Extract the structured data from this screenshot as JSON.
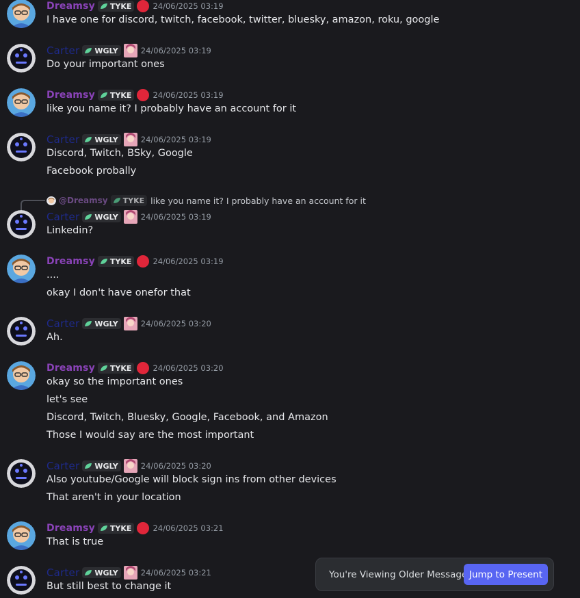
{
  "users": {
    "dreamsy": {
      "name": "Dreamsy",
      "tag": "TYKE"
    },
    "carter": {
      "name": "Carter",
      "tag": "WGLY"
    }
  },
  "messages": [
    {
      "user": "dreamsy",
      "time": "24/06/2025 03:19",
      "lines": [
        "I have one for discord, twitch, facebook, twitter, bluesky, amazon, roku, google"
      ]
    },
    {
      "user": "carter",
      "time": "24/06/2025 03:19",
      "lines": [
        "Do your important ones"
      ]
    },
    {
      "user": "dreamsy",
      "time": "24/06/2025 03:19",
      "lines": [
        "like you name it? I probably have an account for it"
      ]
    },
    {
      "user": "carter",
      "time": "24/06/2025 03:19",
      "lines": [
        "Discord, Twitch, BSky, Google",
        "Facebook probally"
      ]
    },
    {
      "user": "carter",
      "time": "24/06/2025 03:19",
      "lines": [
        "Linkedin?"
      ]
    },
    {
      "user": "dreamsy",
      "time": "24/06/2025 03:19",
      "lines": [
        "....",
        "okay I don't have onefor that"
      ]
    },
    {
      "user": "carter",
      "time": "24/06/2025 03:20",
      "lines": [
        "Ah."
      ]
    },
    {
      "user": "dreamsy",
      "time": "24/06/2025 03:20",
      "lines": [
        "okay so the important ones",
        "let's see",
        "Discord, Twitch, Bluesky, Google, Facebook, and Amazon",
        "Those I would say are the most important"
      ]
    },
    {
      "user": "carter",
      "time": "24/06/2025 03:20",
      "lines": [
        "Also youtube/Google will block sign ins from other devices",
        "That aren't in your location"
      ]
    },
    {
      "user": "dreamsy",
      "time": "24/06/2025 03:21",
      "lines": [
        "That is true"
      ]
    },
    {
      "user": "carter",
      "time": "24/06/2025 03:21",
      "lines": [
        "But still best to change it"
      ]
    }
  ],
  "reply": {
    "mention": "@Dreamsy",
    "tag": "TYKE",
    "text": "like you name it? I probably have an account for it"
  },
  "older_bar": {
    "text": "You're Viewing Older Messages",
    "button": "Jump to Present"
  },
  "colors": {
    "background": "#1a1a1e",
    "dreamsy_name": "#8a43b8",
    "carter_name": "#1e2a8c",
    "status_dot": "#e0263a",
    "accent_button": "#5865f2"
  }
}
